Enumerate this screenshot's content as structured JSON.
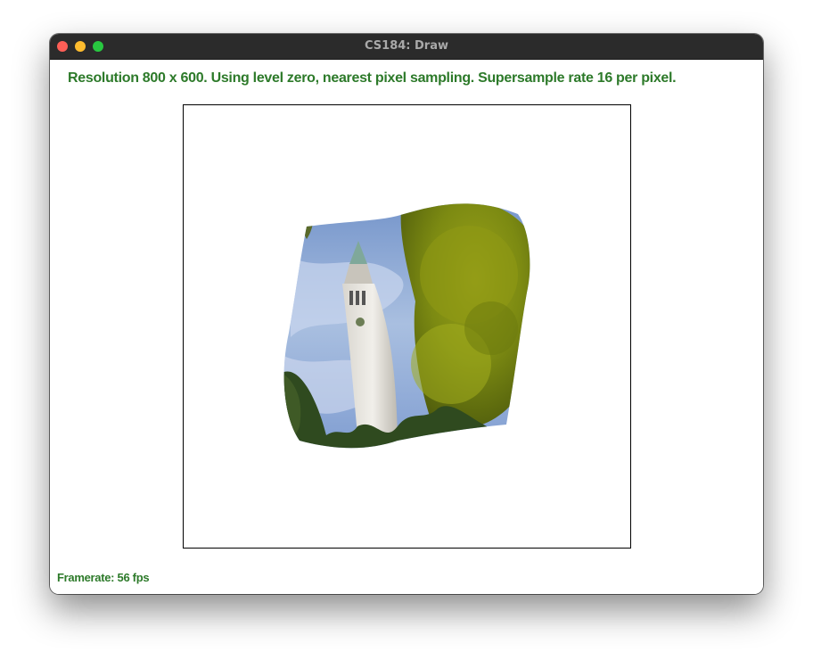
{
  "window": {
    "title": "CS184: Draw"
  },
  "status": {
    "text": "Resolution 800 x 600. Using level zero, nearest pixel sampling. Supersample rate 16 per pixel."
  },
  "footer": {
    "framerate": "Framerate: 56 fps"
  },
  "colors": {
    "status_text": "#2d7a2a",
    "titlebar": "#2b2b2b",
    "close": "#fe5f57",
    "minimize": "#febc2e",
    "maximize": "#28c840"
  }
}
